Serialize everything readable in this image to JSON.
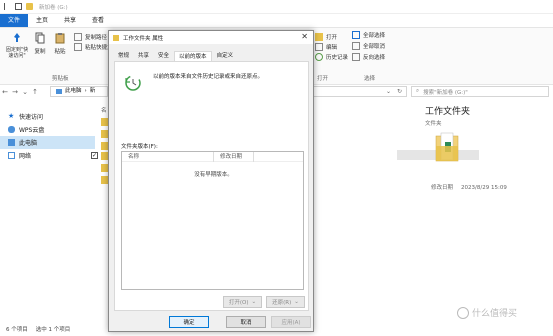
{
  "explorer": {
    "title": "新加卷 (G:)",
    "ribbon_tabs": [
      "文件",
      "主页",
      "共享",
      "查看"
    ],
    "ribbon": {
      "pin_quick_access": "固定到\"快速访问\"",
      "copy": "复制",
      "paste": "粘贴",
      "copy_path": "复制路径",
      "paste_shortcut": "粘贴快捷方式",
      "clipboard_group": "剪贴板",
      "open": "打开",
      "edit": "编辑",
      "history": "历史记录",
      "select_all": "全部选择",
      "select_none": "全部取消",
      "invert_selection": "反向选择",
      "open_group": "打开",
      "select_group": "选择"
    },
    "address": {
      "segments": [
        "此电脑",
        "新"
      ],
      "search_placeholder": "搜索\"新加卷 (G:)\""
    },
    "nav": [
      {
        "label": "快速访问",
        "icon": "star-icon"
      },
      {
        "label": "WPS云盘",
        "icon": "cloud-icon"
      },
      {
        "label": "此电脑",
        "icon": "computer-icon",
        "selected": true
      },
      {
        "label": "网络",
        "icon": "network-icon"
      }
    ],
    "filelist_header": "名",
    "details": {
      "title": "工作文件夹",
      "subtitle": "文件夹",
      "modified_label": "修改日期",
      "modified_value": "2023/8/29 15:09"
    },
    "status": {
      "count": "6 个项目",
      "selected": "选中 1 个项目"
    },
    "watermark": "什么值得买"
  },
  "dialog": {
    "title": "工作文件夹 属性",
    "close": "✕",
    "tabs": [
      "常规",
      "共享",
      "安全",
      "以前的版本",
      "自定义"
    ],
    "active_tab": 3,
    "hint": "以前的版本来自文件历史记录或来自还原点。",
    "versions_label": "文件夹版本(F):",
    "columns": [
      "名称",
      "修改日期"
    ],
    "empty_text": "没有早期版本。",
    "open_button": "打开(O)",
    "restore_button": "还原(R)",
    "ok": "确定",
    "cancel": "取消",
    "apply": "应用(A)"
  },
  "colors": {
    "accent": "#1a6fd0",
    "folder": "#e8c24a",
    "nav_selected": "#cce4f7"
  }
}
